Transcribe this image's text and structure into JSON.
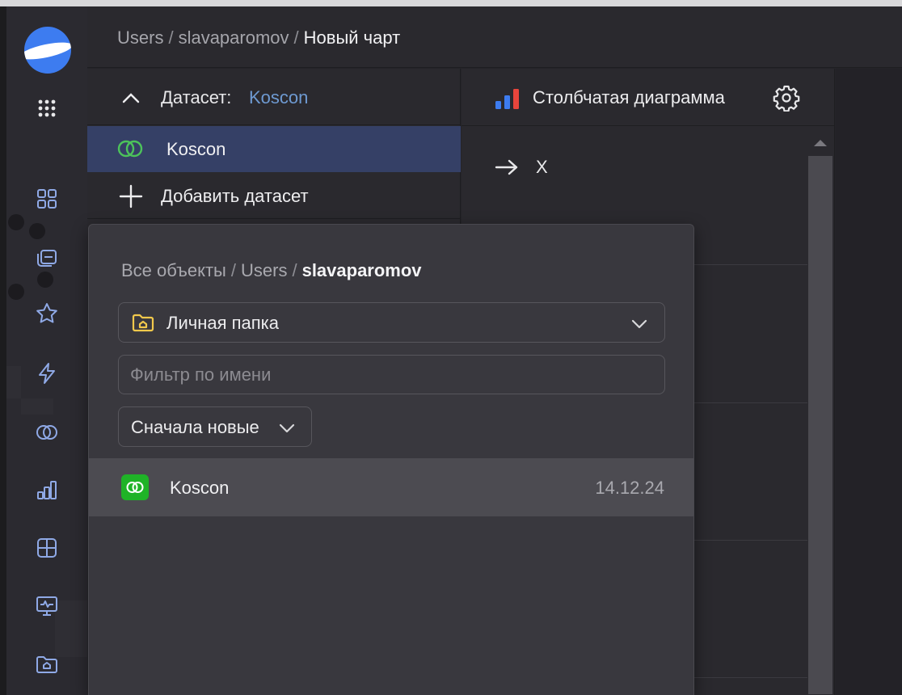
{
  "header": {
    "breadcrumb": [
      "Users",
      "slavaparomov",
      "Новый чарт"
    ]
  },
  "nav": {
    "icons": [
      "grid-icon",
      "collection-icon",
      "star-icon",
      "lightning-icon",
      "dataset-icon",
      "chart-icon",
      "table-icon",
      "monitor-icon",
      "folder-icon"
    ]
  },
  "dataset_panel": {
    "label": "Датасет:",
    "value": "Koscon",
    "item_name": "Koscon",
    "add_label": "Добавить датасет"
  },
  "viz_panel": {
    "title": "Столбчатая диаграмма",
    "axis_label": "X"
  },
  "popup": {
    "breadcrumb": [
      "Все объекты",
      "Users",
      "slavaparomov"
    ],
    "folder": "Личная папка",
    "filter_placeholder": "Фильтр по имени",
    "sort": "Сначала новые",
    "rows": [
      {
        "name": "Koscon",
        "date": "14.12.24"
      }
    ]
  },
  "colors": {
    "accent_blue": "#3d7cf0",
    "dataset_green": "#1fb327",
    "selected_row": "#354066",
    "link_blue": "#6e9ad2",
    "folder_yellow": "#f2c94c"
  }
}
